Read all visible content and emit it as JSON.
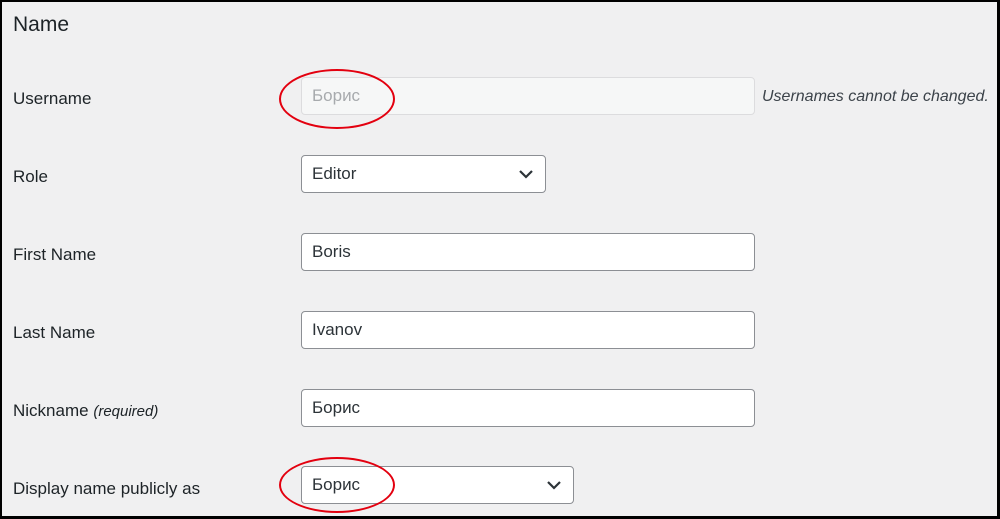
{
  "section_title": "Name",
  "fields": {
    "username": {
      "label": "Username",
      "value": "Борис",
      "description": "Usernames cannot be changed."
    },
    "role": {
      "label": "Role",
      "selected": "Editor"
    },
    "first_name": {
      "label": "First Name",
      "value": "Boris"
    },
    "last_name": {
      "label": "Last Name",
      "value": "Ivanov"
    },
    "nickname": {
      "label": "Nickname",
      "required_note": "(required)",
      "value": "Борис"
    },
    "display_name": {
      "label": "Display name publicly as",
      "selected": "Борис"
    }
  },
  "annotation_color": "#e3000f"
}
